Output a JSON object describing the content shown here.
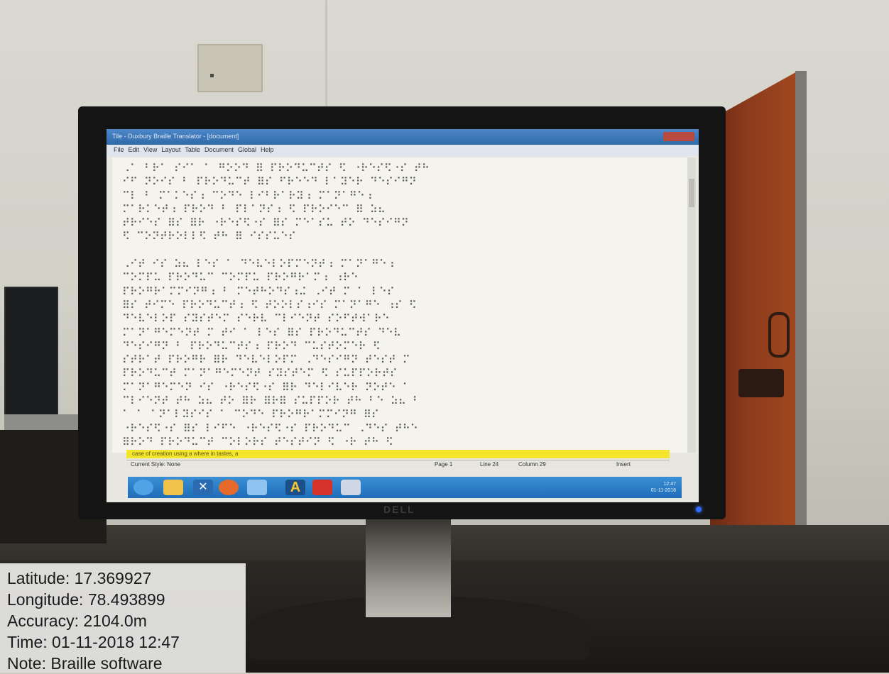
{
  "screen": {
    "window_title": "Tile - Duxbury Braille Translator - [document]",
    "menu": [
      "File",
      "Edit",
      "View",
      "Layout",
      "Table",
      "Document",
      "Global",
      "Help"
    ],
    "braille_lines": [
      "⠠⠁ ⠃⠗⠁ ⠎⠊⠁ ⠁ ⠛⠕⠕⠙ ⠿ ⠏⠗⠕⠙⠥⠉⠞⠎ ⠫ ⠐⠗⠑⠎⠫⠐⠎ ⠞⠓",
      "⠊⠋ ⠝⠕⠊⠎ ⠃ ⠏⠗⠕⠙⠥⠉⠞ ⠿⠎ ⠋⠗⠑⠑⠙ ⠇⠁⠽⠑⠗ ⠙⠑⠎⠊⠛⠝",
      "⠉⠇ ⠃ ⠍⠁⠅⠑⠎⠰ ⠉⠕⠙⠑ ⠇⠊⠃⠗⠁⠗⠽⠰ ⠍⠁⠝⠁⠛⠑⠰",
      "⠍⠁⠗⠅⠑⠞⠰ ⠏⠗⠕⠙ ⠃ ⠏⠇⠁⠝⠎⠰ ⠫ ⠏⠗⠕⠊⠑⠉ ⠿ ⠵⠦",
      "⠞⠗⠊⠑⠎ ⠿⠎ ⠿⠗ ⠐⠗⠑⠎⠫⠐⠎ ⠿⠎ ⠍⠑⠁⠎⠥ ⠞⠕ ⠙⠑⠎⠊⠛⠝",
      "⠫ ⠉⠕⠝⠞⠗⠕⠇⠇⠫ ⠞⠓ ⠿ ⠊⠎⠎⠥⠑⠎",
      "",
      "⠠⠊⠞ ⠊⠎ ⠵⠦ ⠇⠑⠎ ⠁ ⠙⠑⠧⠑⠇⠕⠏⠍⠑⠝⠞⠰ ⠍⠁⠝⠁⠛⠑⠰",
      "⠉⠕⠍⠏⠥ ⠏⠗⠕⠙⠥⠉ ⠉⠕⠍⠏⠥ ⠏⠗⠕⠛⠗⠁⠍⠰ ⠰⠗⠑",
      "⠏⠗⠕⠛⠗⠁⠍⠍⠊⠝⠛⠰ ⠃ ⠍⠑⠞⠓⠕⠙⠎⠰⠬ ⠠⠊⠞ ⠍ ⠁ ⠇⠑⠎",
      "⠿⠎ ⠞⠊⠍⠑ ⠏⠗⠕⠙⠥⠉⠞⠰ ⠫ ⠞⠕⠕⠇⠎⠰⠊⠎ ⠍⠁⠝⠁⠛⠑ ⠰⠎ ⠫",
      "⠙⠑⠧⠑⠇⠕⠏ ⠎⠽⠎⠞⠑⠍ ⠎⠑⠗⠧ ⠉⠇⠊⠑⠝⠞ ⠎⠕⠋⠞⠺⠁⠗⠑",
      "⠍⠁⠝⠁⠛⠑⠍⠑⠝⠞ ⠍ ⠞⠊ ⠁ ⠇⠑⠎ ⠿⠎ ⠏⠗⠕⠙⠥⠉⠞⠎ ⠙⠑⠧",
      "⠙⠑⠎⠊⠛⠝ ⠃ ⠏⠗⠕⠙⠥⠉⠞⠎⠰ ⠏⠗⠕⠙ ⠉⠥⠎⠞⠕⠍⠑⠗ ⠫",
      "⠎⠞⠗⠁⠞ ⠏⠗⠕⠛⠗ ⠿⠗ ⠙⠑⠧⠑⠇⠕⠏⠍ ⠠⠙⠑⠎⠊⠛⠝ ⠞⠑⠎⠞ ⠍",
      "⠏⠗⠕⠙⠥⠉⠞ ⠍⠁⠝⠁⠛⠑⠍⠑⠝⠞ ⠎⠽⠎⠞⠑⠍ ⠫ ⠎⠥⠏⠏⠕⠗⠞⠎",
      "⠍⠁⠝⠁⠛⠑⠍⠑⠝ ⠊⠎ ⠐⠗⠑⠎⠫⠐⠎ ⠿⠗ ⠙⠑⠇⠊⠧⠑⠗ ⠝⠕⠞⠑ ⠁",
      "⠉⠇⠊⠑⠝⠞ ⠞⠓ ⠵⠦ ⠞⠕ ⠿⠗ ⠿⠗⠿ ⠎⠥⠏⠏⠕⠗ ⠞⠓ ⠃⠑ ⠵⠦ ⠃",
      "⠁ ⠁ ⠁⠝⠁⠇⠽⠎⠊⠎ ⠁ ⠉⠕⠙⠑ ⠏⠗⠕⠛⠗⠁⠍⠍⠊⠝⠛ ⠿⠎",
      "⠐⠗⠑⠎⠫⠐⠎ ⠿⠎ ⠇⠊⠋⠑ ⠐⠗⠑⠎⠫⠐⠎ ⠏⠗⠕⠙⠥⠉ ⠠⠙⠑⠎ ⠞⠓⠑",
      "⠿⠗⠕⠙ ⠏⠗⠕⠙⠥⠉⠞ ⠉⠕⠇⠕⠗⠎ ⠞⠑⠎⠞⠊⠝ ⠫ ⠐⠗ ⠞⠓ ⠫",
      "⠠⠉⠕⠙⠑ ⠃ ⠏⠗⠕⠙⠥⠉⠞ ⠇⠊⠋⠑ ⠞ ⠁⠝⠞ ⠿⠗ ⠍⠁⠝⠁⠛⠑ ⠿⠗"
    ],
    "highlight_line": "case of creation using a where in tastes, a",
    "statusbar": {
      "left": "Current Style: None",
      "page": "Page 1",
      "line": "Line 24",
      "column": "Column 29",
      "right": "Insert"
    },
    "clock": {
      "time": "12:47",
      "date": "01-11-2018"
    }
  },
  "bezel": {
    "logo": "DELL"
  },
  "overlay": {
    "latitude": "Latitude: 17.369927",
    "longitude": "Longitude: 78.493899",
    "accuracy": "Accuracy: 2104.0m",
    "time": "Time: 01-11-2018 12:47",
    "note": "Note: Braille software"
  },
  "colors": {
    "taskbar": "#1f6db7",
    "highlight": "#f2e52a",
    "door": "#8a3a1c",
    "power_led": "#2f6cff"
  },
  "icons": [
    "start-orb-icon",
    "folder-icon",
    "x-icon",
    "firefox-icon",
    "window-icon",
    "a-app-icon",
    "red-app-icon",
    "braille-app-icon"
  ]
}
